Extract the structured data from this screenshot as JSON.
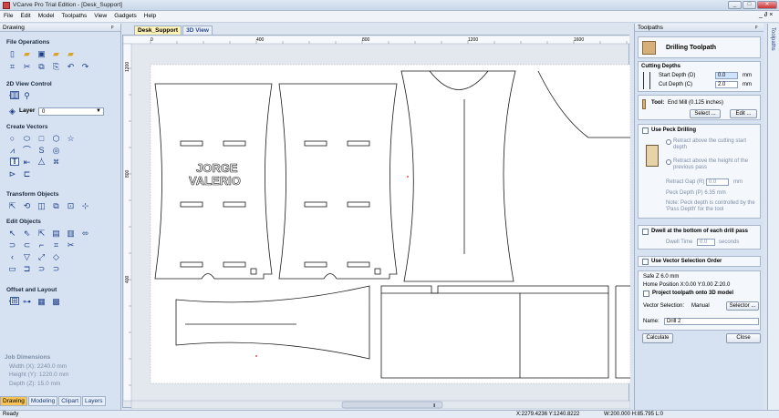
{
  "window": {
    "title": "VCarve Pro Trial Edition - [Desk_Support]",
    "min": "_",
    "max": "□",
    "close": "✕"
  },
  "menu": [
    "File",
    "Edit",
    "Model",
    "Toolpaths",
    "View",
    "Gadgets",
    "Help"
  ],
  "menu_right": "_ ∂ ×",
  "drawing_panel": {
    "title": "Drawing",
    "pin": "ᵖ",
    "sections": {
      "file_ops": "File Operations",
      "view_2d": "2D View Control",
      "create_vectors": "Create Vectors",
      "transform": "Transform Objects",
      "edit": "Edit Objects",
      "offset": "Offset and Layout"
    },
    "layer_label": "Layer",
    "layer_value": "0",
    "layer_arrow": "▼",
    "job_dimensions": {
      "title": "Job Dimensions",
      "width": "Width  (X): 2240.0 mm",
      "height": "Height (Y): 1220.0 mm",
      "depth": "Depth  (Z): 15.0 mm"
    },
    "tabs": [
      "Drawing",
      "Modeling",
      "Clipart",
      "Layers"
    ]
  },
  "doc_tabs": [
    "Desk_Support",
    "3D View"
  ],
  "ruler": {
    "top": [
      "0",
      "400",
      "800",
      "1200",
      "1600"
    ],
    "left": [
      "1200",
      "800",
      "400"
    ]
  },
  "canvas": {
    "text_line1": "JORGE",
    "text_line2": "VALERIO",
    "hscroll": "⦀"
  },
  "toolpaths_panel": {
    "title": "Toolpaths",
    "pin": "ᵖ",
    "side_tab": "Toolpaths",
    "heading": "Drilling Toolpath",
    "cutting_depths": "Cutting Depths",
    "start_depth_label": "Start Depth (D)",
    "start_depth": "0.0",
    "start_unit": "mm",
    "cut_depth_label": "Cut Depth (C)",
    "cut_depth": "2.0",
    "cut_unit": "mm",
    "tool_label": "Tool:",
    "tool_value": "End Mill (0.125 inches)",
    "select_btn": "Select ...",
    "edit_btn": "Edit ...",
    "peck_label": "Use Peck Drilling",
    "peck_opt1": "Retract above the cutting start depth",
    "peck_opt2": "Retract above the height of the previous pass",
    "retract_gap_label": "Retract Gap (R)",
    "retract_gap": "0.0",
    "retract_unit": "mm",
    "peck_depth": "Peck Depth (P)   6.35 mm",
    "peck_note": "Note: Peck depth is controlled by the 'Pass Depth' for the tool",
    "dwell_label": "Dwell at the bottom of each drill pass",
    "dwell_time_label": "Dwell Time",
    "dwell_time": "0.0",
    "dwell_unit": "seconds",
    "vector_order_label": "Use Vector Selection Order",
    "safe_z": "Safe Z          6.0 mm",
    "home": "Home Position  X:0.00 Y:0.00 Z:20.0",
    "project_label": "Project toolpath onto 3D model",
    "vector_sel_label": "Vector Selection:",
    "vector_sel_value": "Manual",
    "selector_btn": "Selector ...",
    "name_label": "Name:",
    "name_value": "Drill 2",
    "calculate_btn": "Calculate",
    "close_btn": "Close"
  },
  "status": {
    "left": "Ready",
    "coords": "X:2279.4236 Y:1240.8222",
    "dims": "W:200.000  H:85.795  L:0"
  }
}
